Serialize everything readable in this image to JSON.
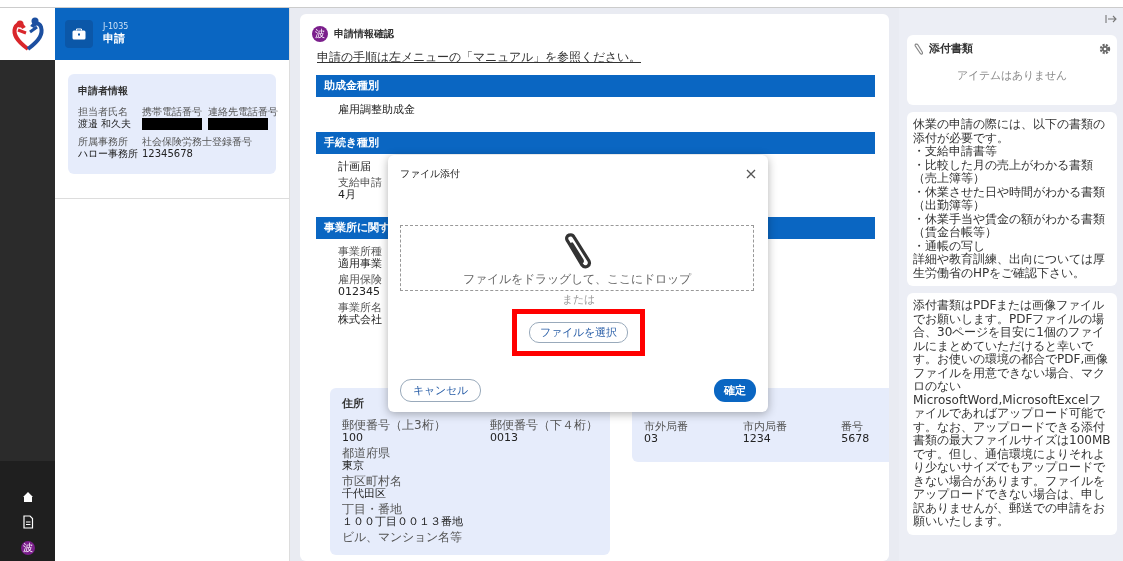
{
  "sidebar": {
    "items": [
      {
        "kind": "home"
      },
      {
        "kind": "document"
      },
      {
        "kind": "avatar",
        "label": "波"
      }
    ]
  },
  "header": {
    "code": "J-1035",
    "title": "申請"
  },
  "applicant": {
    "title": "申請者情報",
    "fields": [
      {
        "label": "担当者氏名",
        "value": "渡邉 和久夫"
      },
      {
        "label": "携帯電話番号",
        "redacted": true
      },
      {
        "label": "連絡先電話番号",
        "redacted": true
      },
      {
        "label": "所属事務所",
        "value": "ハロー事務所"
      },
      {
        "label": "社会保険労務士登録番号",
        "value": "12345678"
      }
    ]
  },
  "main": {
    "avatar": "波",
    "title": "申請情報確認",
    "link": "申請の手順は左メニューの「マニュアル」を参照ください。",
    "sections": [
      {
        "heading": "助成金種別",
        "items": [
          {
            "value": "雇用調整助成金"
          }
        ]
      },
      {
        "heading": "手続き種別",
        "items": [
          {
            "value": "計画届"
          },
          {
            "label": "支給申請",
            "value": "4月"
          }
        ]
      },
      {
        "heading": "事業所に関す",
        "items": [
          {
            "label": "事業所種",
            "value": "適用事業"
          },
          {
            "label": "雇用保険",
            "value": "012345"
          },
          {
            "label": "事業所名",
            "value": "株式会社"
          }
        ]
      }
    ],
    "address": {
      "title": "住所",
      "rows": [
        [
          {
            "label": "郵便番号（上3桁）",
            "value": "100"
          },
          {
            "label": "郵便番号（下４桁）",
            "value": "0013"
          }
        ],
        [
          {
            "label": "都道府県",
            "value": "東京"
          }
        ],
        [
          {
            "label": "市区町村名",
            "value": "千代田区"
          }
        ],
        [
          {
            "label": "丁目・番地",
            "value": "１００丁目００１３番地"
          }
        ],
        [
          {
            "label": "ビル、マンション名等"
          }
        ]
      ]
    },
    "phone": {
      "fields": [
        {
          "label": "市外局番",
          "value": "03"
        },
        {
          "label": "市内局番",
          "value": "1234"
        },
        {
          "label": "番号",
          "value": "5678"
        }
      ]
    }
  },
  "modal": {
    "title": "ファイル添付",
    "drop_text": "ファイルをドラッグして、ここにドロップ",
    "or_text": "または",
    "select_button": {
      "label": "ファイルを選択",
      "highlighted": true
    },
    "cancel": "キャンセル",
    "confirm": "確定"
  },
  "attachments": {
    "title": "添付書類",
    "empty": "アイテムはありません"
  },
  "notes": [
    {
      "lines": [
        "休業の申請の際には、以下の書類の添付が必要です。",
        "・支給申請書等",
        "・比較した月の売上がわかる書類（売上簿等）",
        "・休業させた日や時間がわかる書類（出勤簿等）",
        "・休業手当や賃金の額がわかる書類（賃金台帳等）",
        "・通帳の写し",
        "詳細や教育訓練、出向については厚生労働省のHPをご確認下さい。"
      ]
    },
    {
      "lines": [
        "添付書類はPDFまたは画像ファイルでお願いします。PDFファイルの場合、30ページを目安に1個のファイルにまとめていただけると幸いです。お使いの環境の都合でPDF,画像ファイルを用意できない場合、マクロのないMicrosoftWord,MicrosoftExcelファイルであればアップロード可能です。なお、アップロードできる添付書類の最大ファイルサイズは100MBです。但し、通信環境によりそれより少ないサイズでもアップロードできない場合があります。ファイルをアップロードできない場合は、申し訳ありませんが、郵送での申請をお願いいたします。"
      ]
    }
  ]
}
